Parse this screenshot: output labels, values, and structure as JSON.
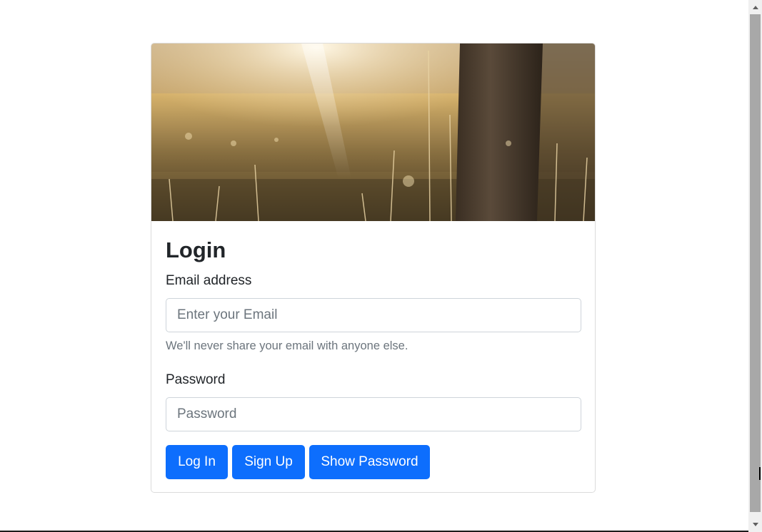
{
  "login": {
    "title": "Login",
    "email_label": "Email address",
    "email_placeholder": "Enter your Email",
    "email_value": "",
    "email_help": "We'll never share your email with anyone else.",
    "password_label": "Password",
    "password_placeholder": "Password",
    "password_value": "",
    "buttons": {
      "login": "Log In",
      "signup": "Sign Up",
      "show_password": "Show Password"
    }
  },
  "colors": {
    "primary": "#0d6efd",
    "text": "#212529",
    "muted": "#6c757d",
    "border": "#ced4da"
  },
  "icons": {
    "scroll_up": "arrow-up-icon",
    "scroll_down": "arrow-down-icon"
  }
}
